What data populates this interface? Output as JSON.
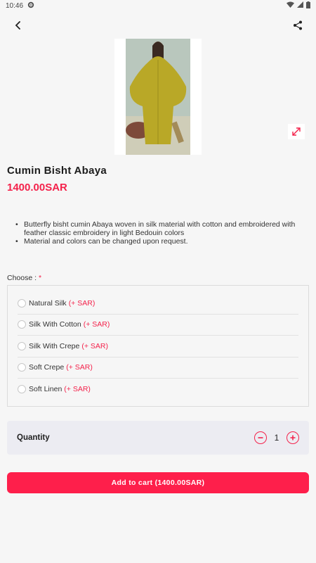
{
  "status_bar": {
    "time": "10:46",
    "icons": [
      "gear-icon",
      "wifi-icon",
      "signal-icon",
      "battery-icon"
    ]
  },
  "app_bar": {
    "back_icon": "back-arrow-icon",
    "share_icon": "share-icon"
  },
  "product": {
    "title": "Cumin Bisht Abaya",
    "price": "1400.00SAR",
    "description": [
      "Butterfly bisht cumin Abaya woven in silk material with cotton and embroidered with feather classic embroidery in light Bedouin colors",
      "Material and colors can be changed upon request."
    ]
  },
  "options": {
    "label": "Choose : ",
    "required_mark": "*",
    "items": [
      {
        "name": "Natural Silk",
        "price": "(+ SAR)"
      },
      {
        "name": "Silk With Cotton",
        "price": "(+ SAR)"
      },
      {
        "name": "Silk With Crepe",
        "price": "(+ SAR)"
      },
      {
        "name": "Soft Crepe",
        "price": "(+ SAR)"
      },
      {
        "name": "Soft Linen",
        "price": "(+ SAR)"
      }
    ]
  },
  "quantity": {
    "label": "Quantity",
    "value": "1"
  },
  "cart": {
    "button_label": "Add to cart (1400.00SAR)"
  },
  "colors": {
    "accent": "#f4224b",
    "background": "#f6f6f6",
    "abaya": "#b9a827"
  }
}
